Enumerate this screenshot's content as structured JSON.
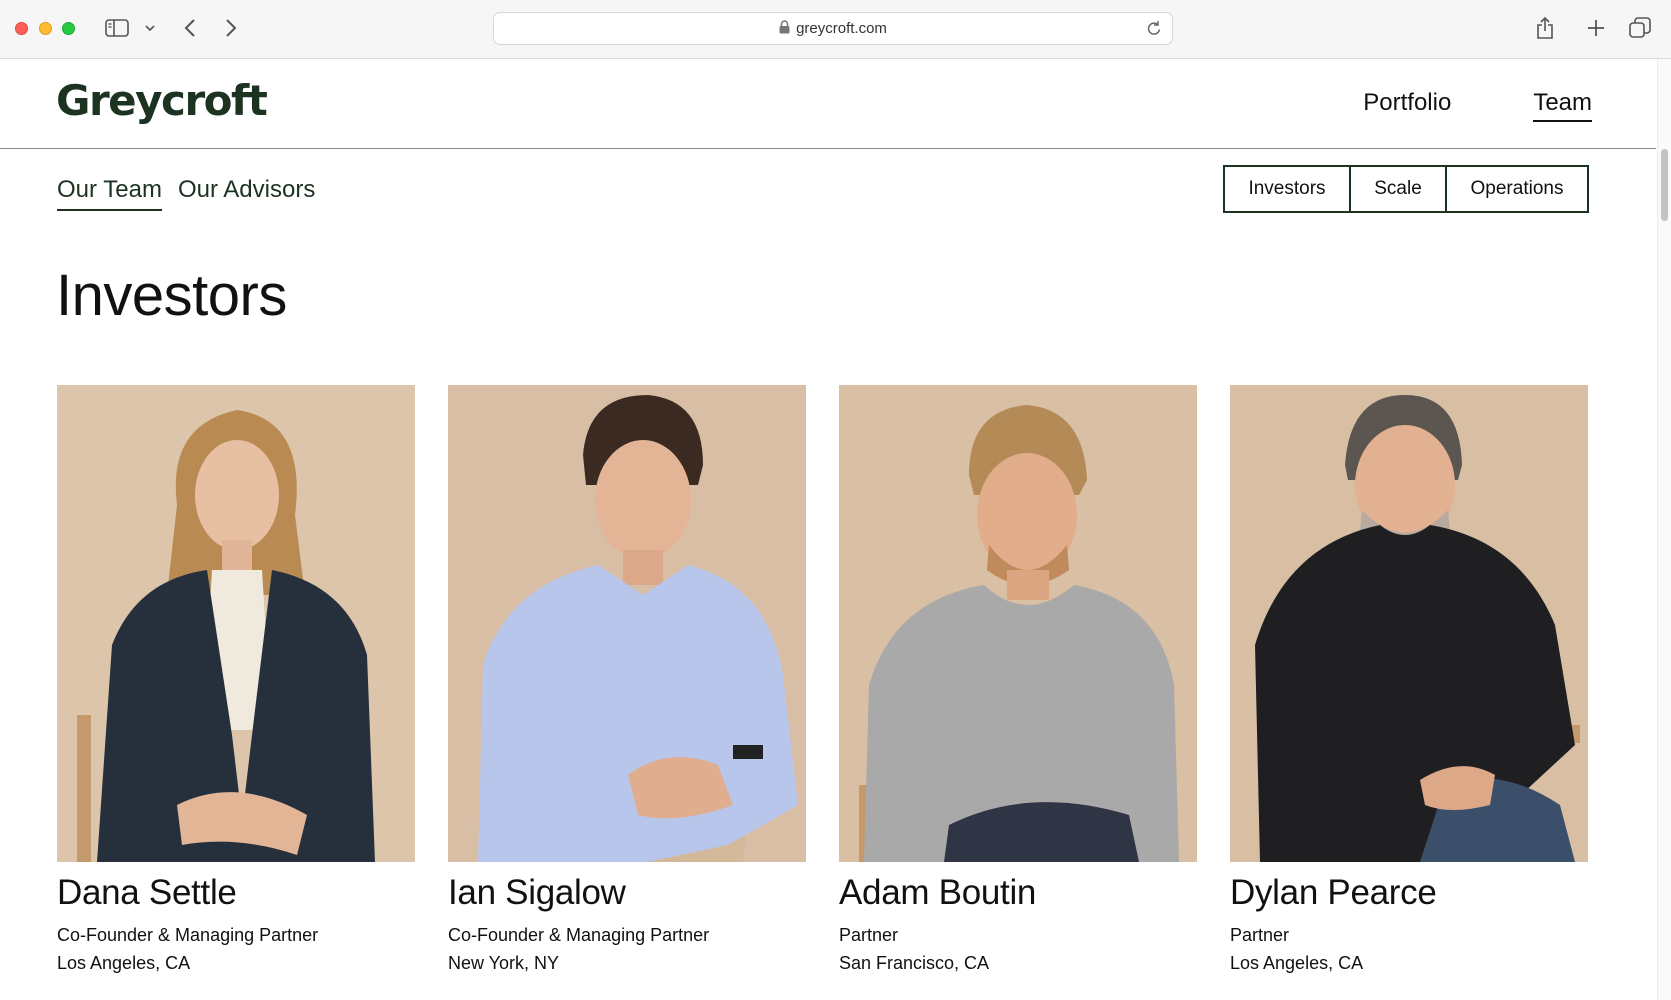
{
  "browser": {
    "url": "greycroft.com"
  },
  "site": {
    "logo": "Greycroft",
    "nav": [
      {
        "label": "Portfolio"
      },
      {
        "label": "Team"
      }
    ]
  },
  "subnav": [
    {
      "label": "Our Team"
    },
    {
      "label": "Our Advisors"
    }
  ],
  "filters": [
    {
      "label": "Investors"
    },
    {
      "label": "Scale"
    },
    {
      "label": "Operations"
    }
  ],
  "section": {
    "title": "Investors"
  },
  "people": [
    {
      "name": "Dana Settle",
      "title": "Co-Founder & Managing Partner",
      "location": "Los Angeles, CA"
    },
    {
      "name": "Ian Sigalow",
      "title": "Co-Founder & Managing Partner",
      "location": "New York, NY"
    },
    {
      "name": "Adam Boutin",
      "title": "Partner",
      "location": "San Francisco, CA"
    },
    {
      "name": "Dylan Pearce",
      "title": "Partner",
      "location": "Los Angeles, CA"
    }
  ],
  "colors": {
    "brand_green": "#1d3322",
    "photo_backdrop": "#dcc6ab"
  }
}
